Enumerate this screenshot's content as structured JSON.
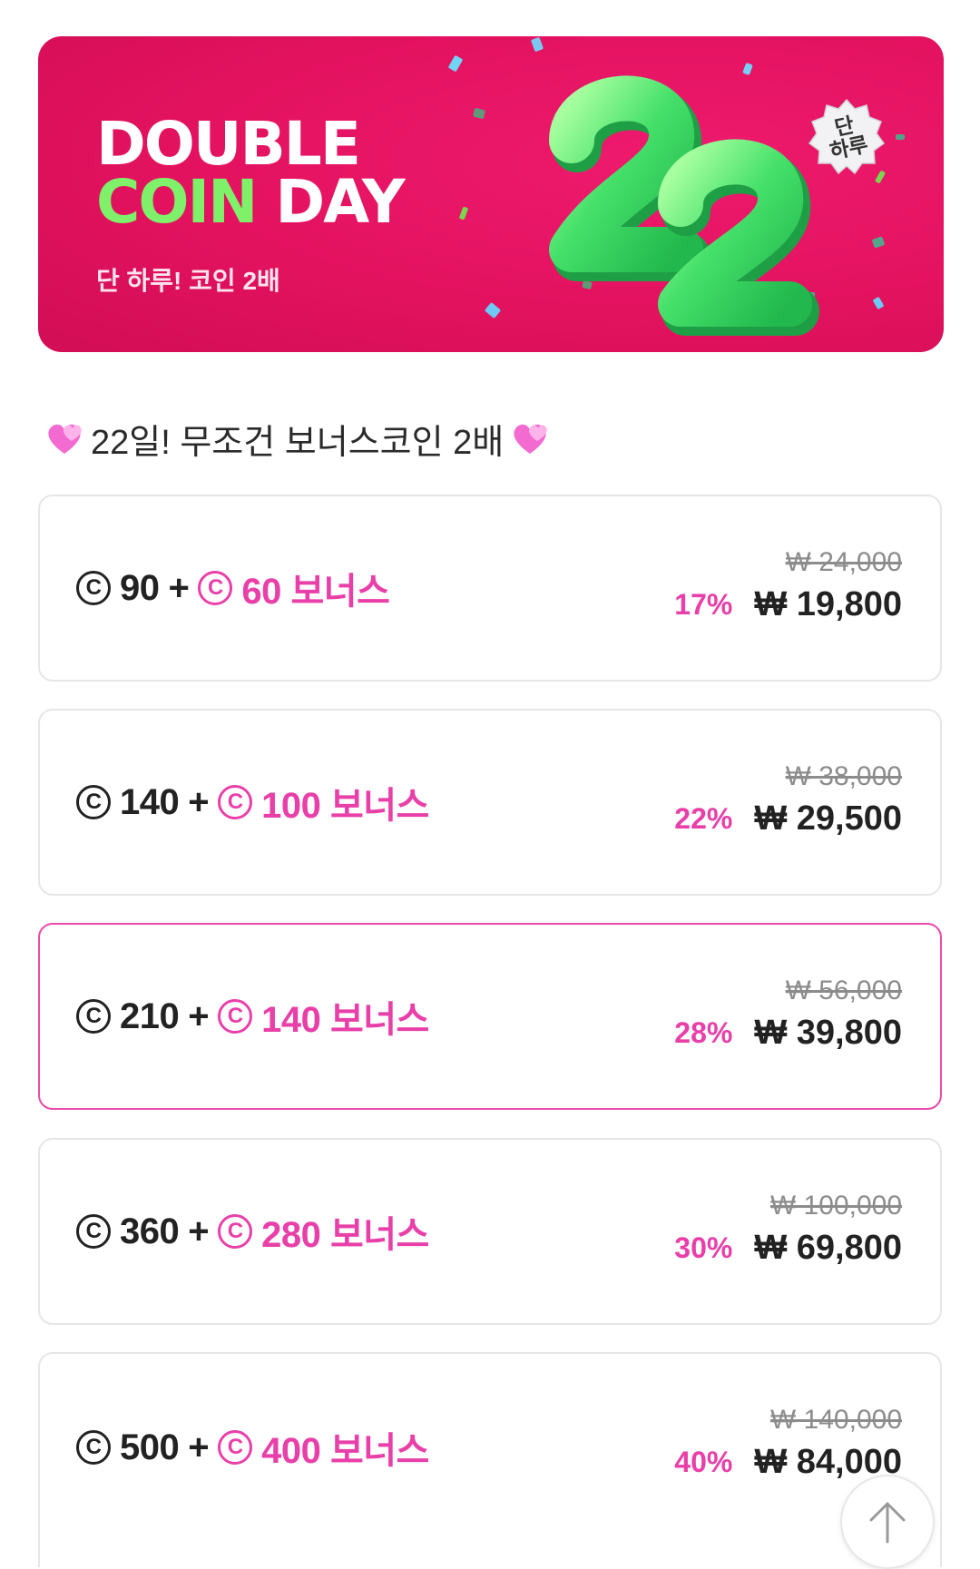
{
  "banner": {
    "line1": "DOUBLE",
    "line2_coin": "COIN",
    "line2_day": "DAY",
    "subtitle": "단 하루! 코인 2배",
    "badge_line1": "단",
    "badge_line2": "하루",
    "colors": {
      "background": "#e3125f",
      "accent_green": "#7ff06a"
    }
  },
  "section": {
    "title": "22일! 무조건 보너스코인 2배",
    "icon": "sparkling-heart-icon"
  },
  "coin_symbol": "C",
  "packages": [
    {
      "coins": "90",
      "bonus": "60 보너스",
      "original_price": "₩ 24,000",
      "discount": "17%",
      "price": "₩ 19,800",
      "selected": false
    },
    {
      "coins": "140",
      "bonus": "100 보너스",
      "original_price": "₩ 38,000",
      "discount": "22%",
      "price": "₩ 29,500",
      "selected": false
    },
    {
      "coins": "210",
      "bonus": "140 보너스",
      "original_price": "₩ 56,000",
      "discount": "28%",
      "price": "₩ 39,800",
      "selected": true
    },
    {
      "coins": "360",
      "bonus": "280 보너스",
      "original_price": "₩ 100,000",
      "discount": "30%",
      "price": "₩ 69,800",
      "selected": false
    },
    {
      "coins": "500",
      "bonus": "400 보너스",
      "original_price": "₩ 140,000",
      "discount": "40%",
      "price": "₩ 84,000",
      "selected": false
    }
  ],
  "plus_sign": "+",
  "accent_color": "#e93fa8",
  "scroll_top_icon": "arrow-up-icon"
}
